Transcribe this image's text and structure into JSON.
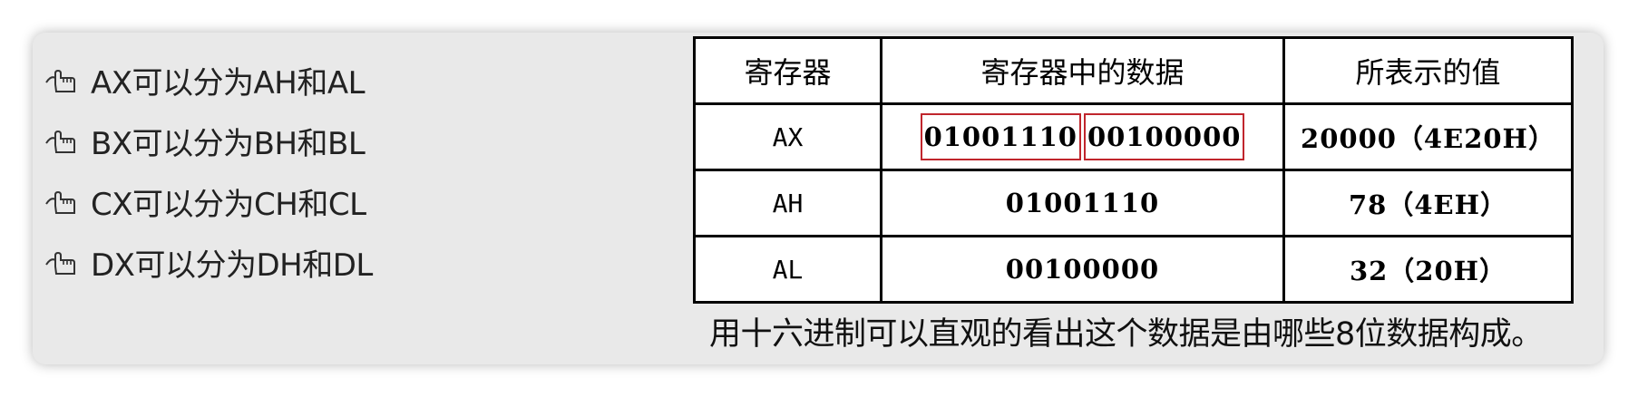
{
  "bullets": [
    {
      "icon": "hand-pointer-icon",
      "text": "AX可以分为AH和AL"
    },
    {
      "icon": "hand-pointer-icon",
      "text": "BX可以分为BH和BL"
    },
    {
      "icon": "hand-pointer-icon",
      "text": "CX可以分为CH和CL"
    },
    {
      "icon": "hand-pointer-icon",
      "text": "DX可以分为DH和DL"
    }
  ],
  "table": {
    "headers": [
      "寄存器",
      "寄存器中的数据",
      "所表示的值"
    ],
    "rows": [
      {
        "register": "AX",
        "data_high": "01001110",
        "data_low": "00100000",
        "value": "20000（4E20H）"
      },
      {
        "register": "AH",
        "data": "01001110",
        "value": "78（4EH）"
      },
      {
        "register": "AL",
        "data": "00100000",
        "value": "32（20H）"
      }
    ],
    "highlight_color": "#c0262d"
  },
  "caption": "用十六进制可以直观的看出这个数据是由哪些8位数据构成。"
}
